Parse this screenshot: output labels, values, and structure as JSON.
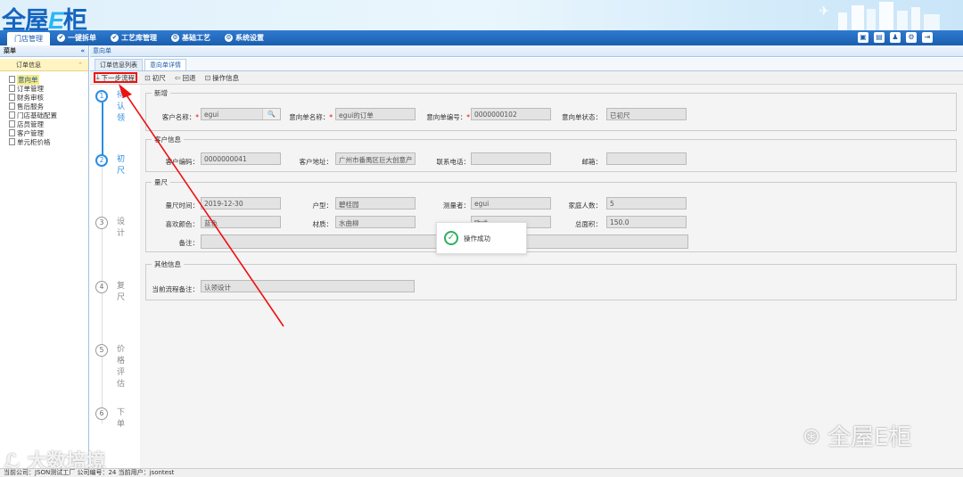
{
  "header": {
    "logo_main": "全屋",
    "logo_e": "E",
    "logo_tail": "柜"
  },
  "menu": [
    {
      "label": "门店管理",
      "icon": ""
    },
    {
      "label": "一键拆单",
      "icon": "check-icon"
    },
    {
      "label": "工艺库管理",
      "icon": "check-icon"
    },
    {
      "label": "基础工艺",
      "icon": "gear-icon"
    },
    {
      "label": "系统设置",
      "icon": "gear-icon"
    }
  ],
  "sidebar": {
    "title": "菜单",
    "collapse": "«",
    "group": "订单信息",
    "group_toggle": "«",
    "items": [
      "意向单",
      "订单管理",
      "财务审核",
      "售后服务",
      "门店基础配置",
      "店员管理",
      "客户管理",
      "单元柜价格"
    ]
  },
  "breadcrumb": "意向单",
  "subtabs": [
    "订单信息列表",
    "意向单详情"
  ],
  "toolbar": {
    "next": "下一步流程",
    "measure": "初尺",
    "back": "回退",
    "oplog": "操作信息"
  },
  "steps": [
    {
      "num": "1",
      "label": "待认领"
    },
    {
      "num": "2",
      "label": "初尺"
    },
    {
      "num": "3",
      "label": "设计"
    },
    {
      "num": "4",
      "label": "复尺"
    },
    {
      "num": "5",
      "label": "价格评估"
    },
    {
      "num": "6",
      "label": "下单"
    }
  ],
  "form": {
    "new": {
      "legend": "新增",
      "customer_name_label": "客户名称：",
      "customer_name": "egui",
      "order_name_label": "意向单名称：",
      "order_name": "egui的订单",
      "order_no_label": "意向单编号：",
      "order_no": "0000000102",
      "status_label": "意向单状态：",
      "status": "已初尺"
    },
    "customer": {
      "legend": "客户信息",
      "code_label": "客户编码：",
      "code": "0000000041",
      "address_label": "客户地址：",
      "address": "广州市番禺区巨大创意产",
      "phone_label": "联系电话：",
      "phone": "",
      "email_label": "邮箱：",
      "email": ""
    },
    "measure": {
      "legend": "量尺",
      "date_label": "量尺时间：",
      "date": "2019-12-30",
      "type_label": "户型：",
      "type": "碧桂园",
      "surveyor_label": "测量者：",
      "surveyor": "egui",
      "family_label": "家庭人数：",
      "family": "5",
      "color_label": "喜欢颜色：",
      "color": "蓝色",
      "material_label": "材质：",
      "material": "水曲柳",
      "style_value": "欧式",
      "area_label": "总面积：",
      "area": "150.0",
      "remark_label": "备注：",
      "remark": ""
    },
    "other": {
      "legend": "其他信息",
      "flow_label": "当前流程备注：",
      "flow": "认领设计"
    }
  },
  "toast": {
    "text": "操作成功"
  },
  "status": {
    "text": "当前公司：JSON测试工厂    公司编号：24    当前用户：jsontest"
  },
  "watermarks": {
    "left": "大数培境",
    "right": "全屋E柜"
  },
  "colors": {
    "primary": "#1a5fae",
    "highlight": "#e11111",
    "success": "#2fae5f"
  }
}
